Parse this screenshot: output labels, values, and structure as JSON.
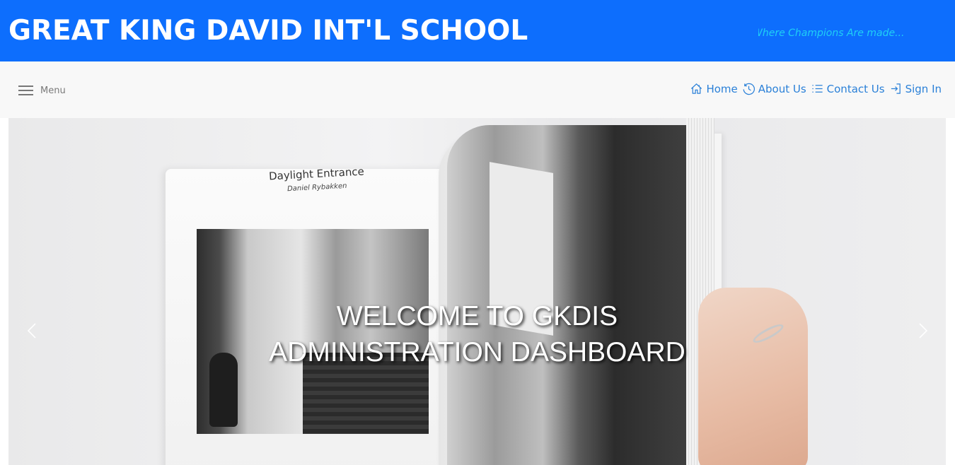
{
  "header": {
    "school_name": "GREAT KING DAVID INT'L SCHOOL",
    "marquee_text": "Where Champions Are made...",
    "background_color": "#0d6efd",
    "marquee_color": "#1fd0f5"
  },
  "navbar": {
    "menu_label": "Menu",
    "links": [
      {
        "label": "Home",
        "icon": "home-icon"
      },
      {
        "label": "About Us",
        "icon": "history-icon"
      },
      {
        "label": "Contact Us",
        "icon": "list-icon"
      },
      {
        "label": "Sign In",
        "icon": "sign-in-icon"
      }
    ],
    "link_color": "#2a80d8"
  },
  "carousel": {
    "caption_line1": "WELCOME TO GKDIS",
    "caption_line2": "ADMINISTRATION DASHBOARD",
    "book_title": "Daylight Entrance",
    "book_author": "Daniel Rybakken"
  }
}
